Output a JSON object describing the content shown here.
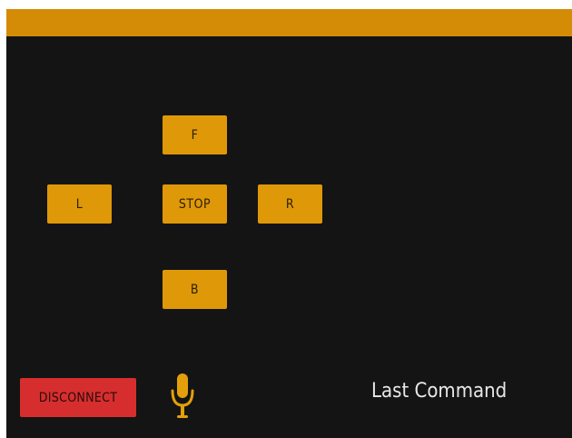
{
  "app_bar": {
    "color": "#d48c07"
  },
  "controls": {
    "forward_label": "F",
    "left_label": "L",
    "stop_label": "STOP",
    "right_label": "R",
    "back_label": "B",
    "button_color": "#df9808"
  },
  "footer": {
    "disconnect_label": "DISCONNECT",
    "disconnect_color": "#d62e2e",
    "mic_icon": "microphone-icon",
    "last_command_label": "Last Command"
  }
}
